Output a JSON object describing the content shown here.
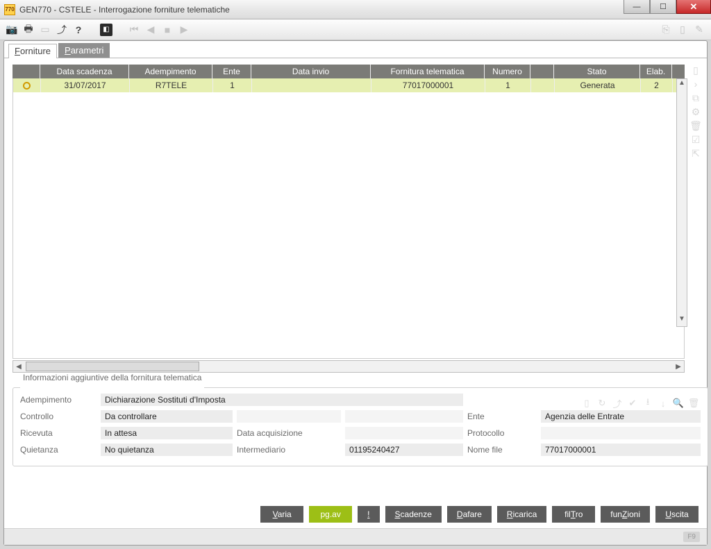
{
  "window": {
    "app_badge": "770",
    "title": "GEN770  -  CSTELE -   Interrogazione forniture telematiche"
  },
  "tabs": {
    "forniture": "Forniture",
    "parametri": "Parametri"
  },
  "grid": {
    "headers": {
      "data_scadenza": "Data scadenza",
      "adempimento": "Adempimento",
      "ente": "Ente",
      "data_invio": "Data invio",
      "fornitura": "Fornitura telematica",
      "numero": "Numero",
      "stato": "Stato",
      "elab": "Elab."
    },
    "rows": [
      {
        "data_scadenza": "31/07/2017",
        "adempimento": "R7TELE",
        "ente": "1",
        "data_invio": "",
        "fornitura": "77017000001",
        "numero": "1",
        "stato": "Generata",
        "elab": "2"
      }
    ]
  },
  "details": {
    "legend": "Informazioni aggiuntive della fornitura telematica",
    "labels": {
      "adempimento": "Adempimento",
      "controllo": "Controllo",
      "ricevuta": "Ricevuta",
      "quietanza": "Quietanza",
      "data_acq": "Data acquisizione",
      "intermediario": "Intermediario",
      "ente": "Ente",
      "protocollo": "Protocollo",
      "nome_file": "Nome file"
    },
    "values": {
      "adempimento": "Dichiarazione Sostituti d'Imposta",
      "controllo": "Da controllare",
      "ricevuta": "In attesa",
      "quietanza": "No quietanza",
      "data_acq": "",
      "intermediario": "01195240427",
      "ente": "Agenzia delle Entrate",
      "protocollo": "",
      "nome_file": "77017000001"
    }
  },
  "buttons": {
    "varia": "Varia",
    "pgav": "pg.av",
    "excl": "!",
    "scadenze": "Scadenze",
    "dafare": "Dafare",
    "ricarica": "Ricarica",
    "filtro": "filTro",
    "funzioni": "funZioni",
    "uscita": "Uscita"
  },
  "status": {
    "fkey": "F9"
  }
}
